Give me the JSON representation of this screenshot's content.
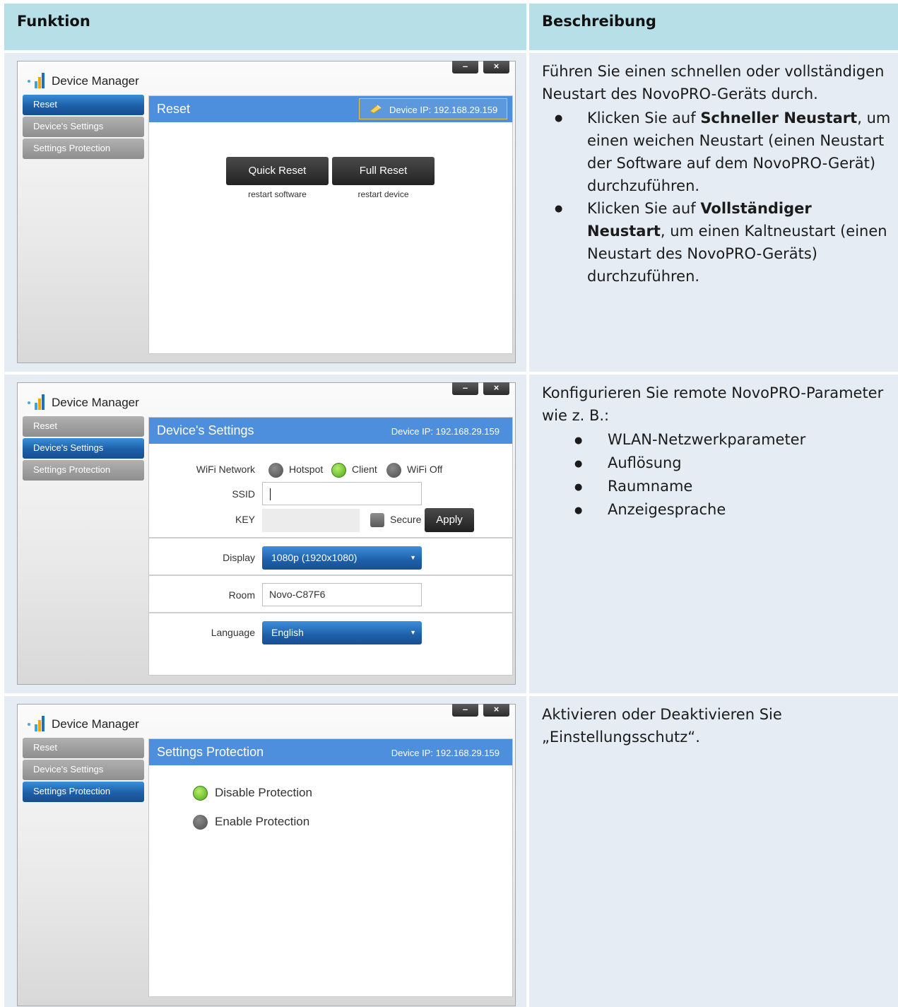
{
  "header": {
    "col1": "Funktion",
    "col2": "Beschreibung"
  },
  "app_title": "Device Manager",
  "window_controls": {
    "minimize": "–",
    "close": "×"
  },
  "nav": {
    "reset": "Reset",
    "settings": "Device's Settings",
    "protection": "Settings Protection"
  },
  "device_ip": "Device IP: 192.168.29.159",
  "row1": {
    "panel_title": "Reset",
    "quick_reset": "Quick Reset",
    "quick_reset_sub": "restart software",
    "full_reset": "Full Reset",
    "full_reset_sub": "restart device",
    "desc_intro": "Führen Sie einen schnellen oder vollständigen Neustart des NovoPRO-Geräts durch.",
    "b1_pre": "Klicken Sie auf ",
    "b1_bold": "Schneller Neustart",
    "b1_post": ", um einen weichen Neustart (einen Neustart der Software auf dem NovoPRO-Gerät) durchzuführen.",
    "b2_pre": "Klicken Sie auf ",
    "b2_bold": "Vollständiger Neustart",
    "b2_post": ", um einen Kaltneustart (einen Neustart des NovoPRO-Geräts) durchzuführen."
  },
  "row2": {
    "panel_title": "Device's Settings",
    "wifi_label": "WiFi Network",
    "opt_hotspot": "Hotspot",
    "opt_client": "Client",
    "opt_wifi_off": "WiFi Off",
    "wifi_selected": "Client",
    "ssid_label": "SSID",
    "ssid_value": "",
    "key_label": "KEY",
    "secure_label": "Secure",
    "apply": "Apply",
    "display_label": "Display",
    "display_value": "1080p (1920x1080)",
    "room_label": "Room",
    "room_value": "Novo-C87F6",
    "language_label": "Language",
    "language_value": "English",
    "desc_intro": "Konfigurieren Sie remote NovoPRO-Parameter wie z. B.:",
    "items": [
      "WLAN-Netzwerkparameter",
      "Auflösung",
      "Raumname",
      "Anzeigesprache"
    ]
  },
  "row3": {
    "panel_title": "Settings Protection",
    "disable": "Disable Protection",
    "enable": "Enable Protection",
    "selected": "Disable Protection",
    "desc": "Aktivieren oder Deaktivieren Sie „Einstellungsschutz“."
  },
  "colors": {
    "header_bg": "#b7dfe7",
    "cell_bg": "#e6ecf3",
    "panel_bar": "#4d8fdc",
    "nav_active": "#1e5fa8",
    "radio_on": "#4fa618"
  }
}
